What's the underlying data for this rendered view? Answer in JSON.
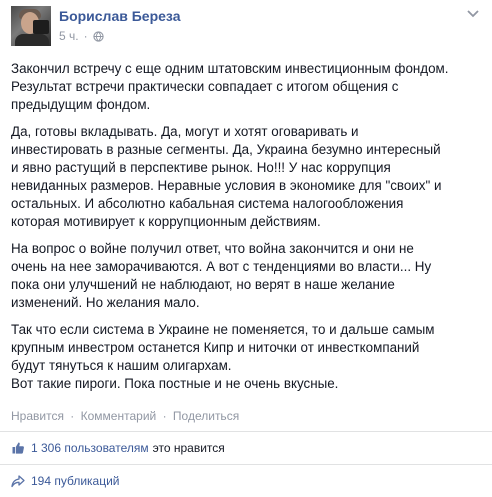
{
  "post": {
    "author": "Борислав Береза",
    "time": "5 ч.",
    "separator": "·",
    "privacy_icon": "globe-icon",
    "menu_icon": "chevron-down-icon",
    "paragraphs": [
      [
        "Закончил встречу с еще одним штатовским инвестиционным фондом.",
        "Результат встречи практически совпадает с итогом общения с",
        "предыдущим фондом."
      ],
      [
        "Да, готовы вкладывать. Да, могут и хотят оговаривать и",
        "инвестировать в разные сегменты. Да, Украина безумно интересный",
        "и явно растущий в перспективе рынок. Но!!! У нас коррупция",
        "невиданных размеров. Неравные условия в экономике для \"своих\" и",
        "остальных. И абсолютно кабальная система налогообложения",
        "которая мотивирует к коррупционным действиям."
      ],
      [
        "На вопрос о войне получил ответ, что война закончится и они не",
        "очень на нее заморачиваются. А вот с тенденциями во власти... Ну",
        "пока они улучшений не наблюдают, но верят в наше желание",
        "изменений. Но желания мало."
      ],
      [
        "Так что если система в Украине не поменяется, то и дальше самым",
        "крупным инвестром останется Кипр и ниточки от инвесткомпаний",
        "будут тянуться к нашим олигархам."
      ],
      [
        "Вот такие пироги. Пока постные и не очень вкусные."
      ]
    ]
  },
  "actions": {
    "like": "Нравится",
    "comment": "Комментарий",
    "share": "Поделиться",
    "separator": "·"
  },
  "likes": {
    "icon": "thumbs-up-icon",
    "count_text": "1 306 пользователям",
    "rest_text": "это нравится"
  },
  "shares": {
    "icon": "share-arrow-icon",
    "text": "194 публикаций"
  },
  "colors": {
    "link": "#3b5998",
    "meta": "#9197a3",
    "text": "#141823",
    "divider": "#e1e2e3"
  }
}
